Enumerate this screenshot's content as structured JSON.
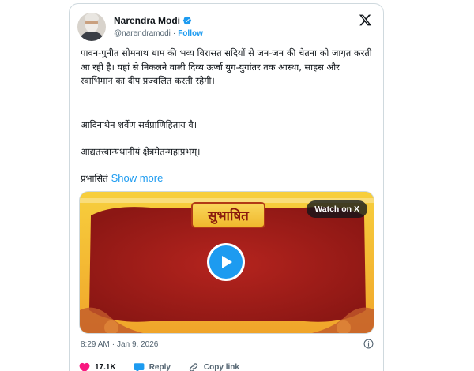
{
  "author": {
    "name": "Narendra Modi",
    "handle": "@narendramodi",
    "separator": "·",
    "follow_label": "Follow",
    "verified": true
  },
  "icons": {
    "verified": "verified-badge-icon",
    "x_logo": "x-logo-icon",
    "info": "info-icon",
    "like": "heart-icon",
    "reply": "reply-icon",
    "copy_link": "link-icon",
    "play": "play-icon"
  },
  "tweet": {
    "paragraph_1": "पावन-पुनीत सोमनाथ धाम की भव्य विरासत सदियों से जन-जन की चेतना को जागृत करती आ रही है। यहां से निकलने वाली दिव्य ऊर्जा युग-युगांतर तक आस्था, साहस और स्वाभिमान का दीप प्रज्वलित करती रहेगी।",
    "paragraph_2": "आदिनाथेन शर्वेण सर्वप्राणिहिताय वै।",
    "paragraph_3": "आद्यतत्त्वान्यथानीयं क्षेत्रमेतन्महाप्रभम्।",
    "paragraph_4": "प्रभासितं",
    "show_more": "Show more"
  },
  "media": {
    "banner_text": "सुभाषित",
    "watch_label": "Watch on X"
  },
  "meta": {
    "time": "8:29 AM",
    "separator": "·",
    "date": "Jan 9, 2026"
  },
  "actions": {
    "likes": "17.1K",
    "reply_label": "Reply",
    "copy_label": "Copy link"
  },
  "colors": {
    "accent": "#1d9bf0",
    "media_red": "#a3201c",
    "media_gold": "#f5c52b",
    "like_red": "#f91880"
  }
}
